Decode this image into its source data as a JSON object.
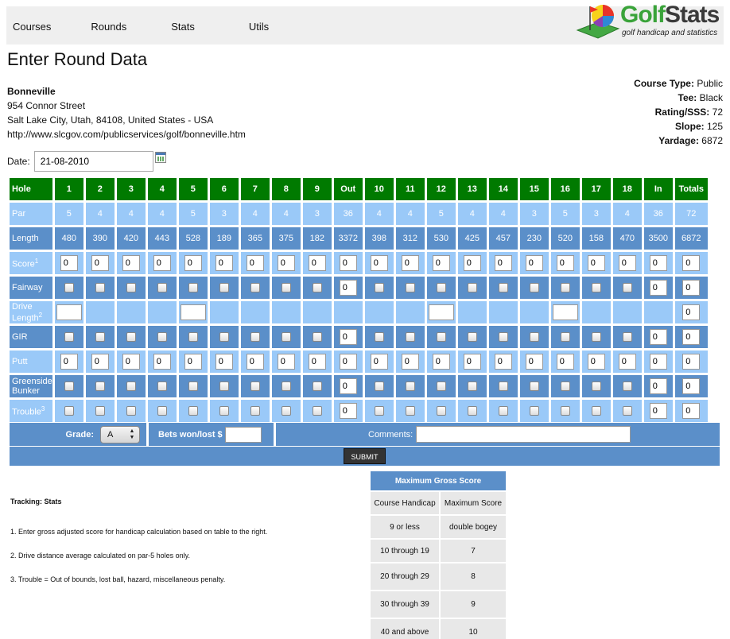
{
  "nav": [
    "Courses",
    "Rounds",
    "Stats",
    "Utils"
  ],
  "logo": {
    "part1": "Golf",
    "part2": "Stats",
    "tagline": "golf handicap and statistics"
  },
  "page_title": "Enter Round Data",
  "course": {
    "name": "Bonneville",
    "street": "954 Connor Street",
    "city": "Salt Lake City, Utah, 84108, United States - USA",
    "url": "http://www.slcgov.com/publicservices/golf/bonneville.htm"
  },
  "course_info": {
    "type_label": "Course Type:",
    "type": "Public",
    "tee_label": "Tee:",
    "tee": "Black",
    "rating_label": "Rating/SSS:",
    "rating": "72",
    "slope_label": "Slope:",
    "slope": "125",
    "yardage_label": "Yardage:",
    "yardage": "6872"
  },
  "date": {
    "label": "Date:",
    "value": "21-08-2010"
  },
  "scorecard": {
    "header": [
      "Hole",
      "1",
      "2",
      "3",
      "4",
      "5",
      "6",
      "7",
      "8",
      "9",
      "Out",
      "10",
      "11",
      "12",
      "13",
      "14",
      "15",
      "16",
      "17",
      "18",
      "In",
      "Totals"
    ],
    "par": [
      "Par",
      "5",
      "4",
      "4",
      "4",
      "5",
      "3",
      "4",
      "4",
      "3",
      "36",
      "4",
      "4",
      "5",
      "4",
      "4",
      "3",
      "5",
      "3",
      "4",
      "36",
      "72"
    ],
    "length": [
      "Length",
      "480",
      "390",
      "420",
      "443",
      "528",
      "189",
      "365",
      "375",
      "182",
      "3372",
      "398",
      "312",
      "530",
      "425",
      "457",
      "230",
      "520",
      "158",
      "470",
      "3500",
      "6872"
    ],
    "row_labels": {
      "score": "Score",
      "score_sup": "1",
      "fairway": "Fairway",
      "drive": "Drive Length",
      "drive_sup": "2",
      "gir": "GIR",
      "putt": "Putt",
      "greenside": "Greenside Bunker",
      "trouble": "Trouble",
      "trouble_sup": "3"
    },
    "default_value": "0"
  },
  "grade": {
    "label": "Grade:",
    "value": "A"
  },
  "bets": {
    "label": "Bets won/lost $"
  },
  "comments": {
    "label": "Comments:"
  },
  "submit": "SUBMIT",
  "notes": {
    "tracking": "Tracking: Stats",
    "n1": "1. Enter gross adjusted score for handicap calculation based on table to the right.",
    "n2": "2. Drive distance average calculated on par-5 holes only.",
    "n3": "3. Trouble = Out of bounds, lost ball, hazard, miscellaneous penalty."
  },
  "max_gross": {
    "title": "Maximum Gross Score",
    "col1": "Course Handicap",
    "col2": "Maximum Score",
    "rows": [
      [
        "9 or less",
        "double bogey"
      ],
      [
        "10 through 19",
        "7"
      ],
      [
        "20 through 29",
        "8"
      ],
      [
        "30 through 39",
        "9"
      ],
      [
        "40 and above",
        "10"
      ]
    ]
  },
  "colors": {
    "header_green": "#007a00",
    "light_blue": "#9ac9f8",
    "dark_blue": "#5b8fc9"
  }
}
